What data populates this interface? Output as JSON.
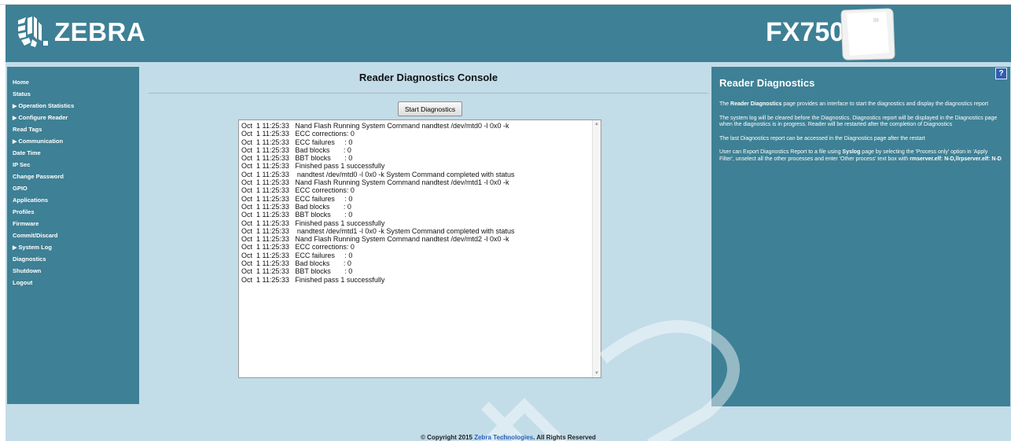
{
  "header": {
    "brand": "ZEBRA",
    "model": "FX7500",
    "logo_icon": "zebra-head-icon",
    "device_image": "fx7500-device-icon"
  },
  "nav": {
    "items": [
      {
        "label": "Home",
        "expandable": false
      },
      {
        "label": "Status",
        "expandable": false
      },
      {
        "label": "Operation Statistics",
        "expandable": true
      },
      {
        "label": "Configure Reader",
        "expandable": true
      },
      {
        "label": "Read Tags",
        "expandable": false
      },
      {
        "label": "Communication",
        "expandable": true
      },
      {
        "label": "Date Time",
        "expandable": false
      },
      {
        "label": "IP Sec",
        "expandable": false
      },
      {
        "label": "Change Password",
        "expandable": false
      },
      {
        "label": "GPIO",
        "expandable": false
      },
      {
        "label": "Applications",
        "expandable": false
      },
      {
        "label": "Profiles",
        "expandable": false
      },
      {
        "label": "Firmware",
        "expandable": false
      },
      {
        "label": "Commit/Discard",
        "expandable": false
      },
      {
        "label": "System Log",
        "expandable": true
      },
      {
        "label": "Diagnostics",
        "expandable": false
      },
      {
        "label": "Shutdown",
        "expandable": false
      },
      {
        "label": "Logout",
        "expandable": false
      }
    ],
    "expand_glyph": "▶"
  },
  "main": {
    "title": "Reader Diagnostics Console",
    "start_button": "Start Diagnostics",
    "log_lines": [
      "Oct  1 11:25:33   Nand Flash Running System Command nandtest /dev/mtd0 -l 0x0 -k",
      "Oct  1 11:25:33   ECC corrections: 0",
      "Oct  1 11:25:33   ECC failures     : 0",
      "Oct  1 11:25:33   Bad blocks       : 0",
      "Oct  1 11:25:33   BBT blocks       : 0",
      "Oct  1 11:25:33   Finished pass 1 successfully",
      "Oct  1 11:25:33    nandtest /dev/mtd0 -l 0x0 -k System Command completed with status",
      "Oct  1 11:25:33   Nand Flash Running System Command nandtest /dev/mtd1 -l 0x0 -k",
      "Oct  1 11:25:33   ECC corrections: 0",
      "Oct  1 11:25:33   ECC failures     : 0",
      "Oct  1 11:25:33   Bad blocks       : 0",
      "Oct  1 11:25:33   BBT blocks       : 0",
      "Oct  1 11:25:33   Finished pass 1 successfully",
      "Oct  1 11:25:33    nandtest /dev/mtd1 -l 0x0 -k System Command completed with status",
      "Oct  1 11:25:33   Nand Flash Running System Command nandtest /dev/mtd2 -l 0x0 -k",
      "Oct  1 11:25:33   ECC corrections: 0",
      "Oct  1 11:25:33   ECC failures     : 0",
      "Oct  1 11:25:33   Bad blocks       : 0",
      "Oct  1 11:25:33   BBT blocks       : 0",
      "Oct  1 11:25:33   Finished pass 1 successfully"
    ]
  },
  "help": {
    "title": "Reader Diagnostics",
    "question_icon": "?",
    "p1_pre": "The ",
    "p1_bold": "Reader Diagnostics",
    "p1_post": " page provides an interface to start the diagnostics and display the diagnostics report",
    "p2": "The system log will be cleared before the Diagnostics. Diagnostics report will be displayed in the Diagnostics page when the diagnostics is in progress. Reader will be restarted after the completion of Diagnostics",
    "p3": "The last Diagnostics report can be accessed in the Diagnostics page after the restart",
    "p4_pre": "User can Export Diagnostics Report to a file using ",
    "p4_bold1": "Syslog",
    "p4_mid": " page by selecting the 'Process only' option in 'Apply Filter', unselect all the other processes and enter 'Other process' text box with ",
    "p4_bold2": "rmserver.elf: N-D,llrpserver.elf: N-D"
  },
  "footer": {
    "prefix": "© Copyright 2015 ",
    "link": "Zebra Technologies",
    "suffix": ". All Rights Reserved"
  },
  "colors": {
    "panel": "#3e8095",
    "background": "#c2dce8",
    "link": "#2b63b8"
  }
}
